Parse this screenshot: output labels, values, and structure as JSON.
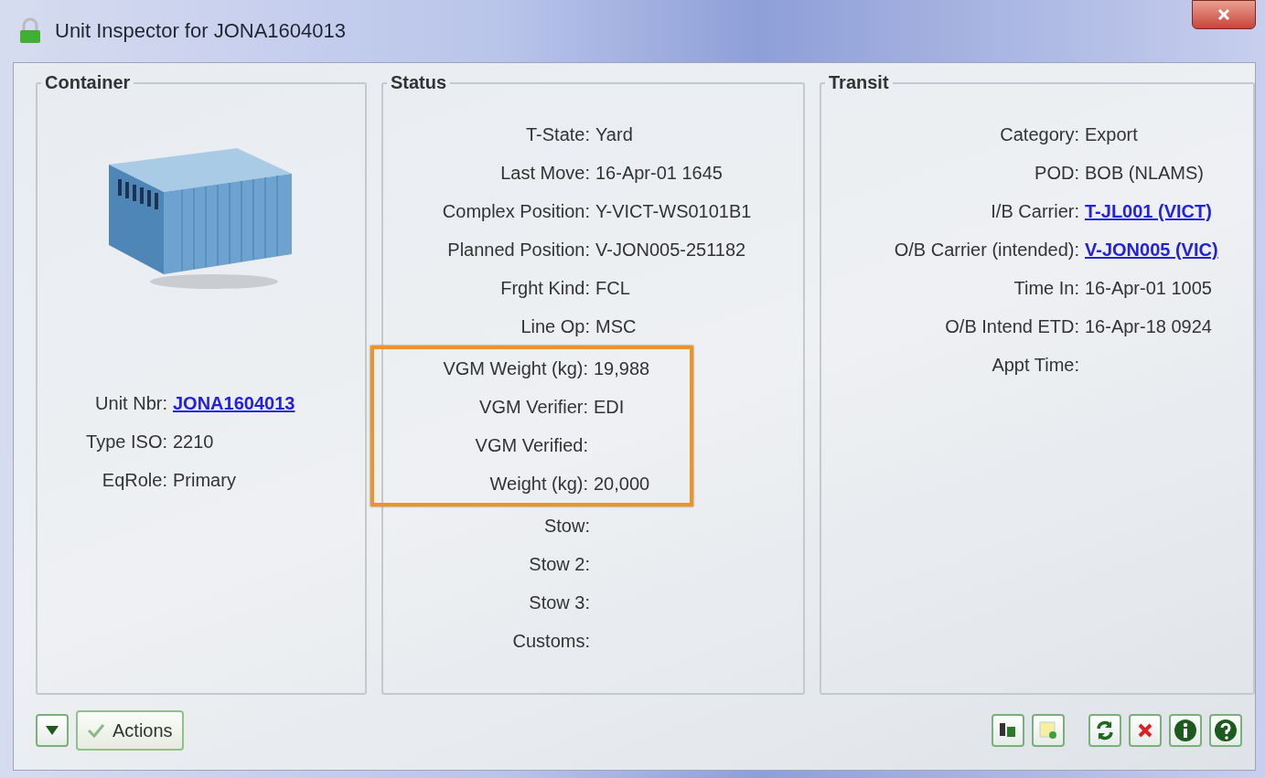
{
  "window": {
    "title": "Unit Inspector for JONA1604013"
  },
  "panels": [
    {
      "kind": "container",
      "title": "Container",
      "fields": [
        {
          "label": "Unit Nbr:",
          "value": "JONA1604013",
          "kind": "link"
        },
        {
          "label": "Type ISO:",
          "value": "2210",
          "kind": "text"
        },
        {
          "label": "EqRole:",
          "value": "Primary",
          "kind": "text"
        }
      ]
    },
    {
      "kind": "status",
      "title": "Status",
      "fields": [
        {
          "label": "T-State:",
          "value": "Yard",
          "kind": "text",
          "highlighted": false
        },
        {
          "label": "Last Move:",
          "value": "16-Apr-01 1645",
          "kind": "text",
          "highlighted": false
        },
        {
          "label": "Complex Position:",
          "value": "Y-VICT-WS0101B1",
          "kind": "text",
          "highlighted": false
        },
        {
          "label": "Planned Position:",
          "value": "V-JON005-251182",
          "kind": "text",
          "highlighted": false
        },
        {
          "label": "Frght Kind:",
          "value": "FCL",
          "kind": "text",
          "highlighted": false
        },
        {
          "label": "Line Op:",
          "value": "MSC",
          "kind": "text",
          "highlighted": false
        },
        {
          "label": "VGM Weight (kg):",
          "value": "19,988",
          "kind": "text",
          "highlighted": true
        },
        {
          "label": "VGM Verifier:",
          "value": "EDI",
          "kind": "text",
          "highlighted": true
        },
        {
          "label": "VGM Verified:",
          "highlighted": true
        },
        {
          "label": "Weight (kg):",
          "value": "20,000",
          "kind": "text",
          "highlighted": true
        },
        {
          "label": "Stow:",
          "highlighted": false
        },
        {
          "label": "Stow 2:",
          "highlighted": false
        },
        {
          "label": "Stow 3:",
          "highlighted": false
        },
        {
          "label": "Customs:",
          "highlighted": false
        }
      ]
    },
    {
      "kind": "transit",
      "title": "Transit",
      "fields": [
        {
          "label": "Category:",
          "value": "Export",
          "kind": "text"
        },
        {
          "label": "POD:",
          "value": "BOB (NLAMS)",
          "kind": "text"
        },
        {
          "label": "I/B Carrier:",
          "value": "T-JL001 (VICT)",
          "kind": "link"
        },
        {
          "label": "O/B Carrier (intended):",
          "value": "V-JON005 (VIC)",
          "kind": "link"
        },
        {
          "label": "Time In:",
          "value": "16-Apr-01 1005",
          "kind": "text"
        },
        {
          "label": "O/B Intend ETD:",
          "value": "16-Apr-18 0924",
          "kind": "text"
        },
        {
          "label": "Appt Time:"
        }
      ]
    }
  ],
  "toolbar": {
    "actions_label": "Actions"
  }
}
